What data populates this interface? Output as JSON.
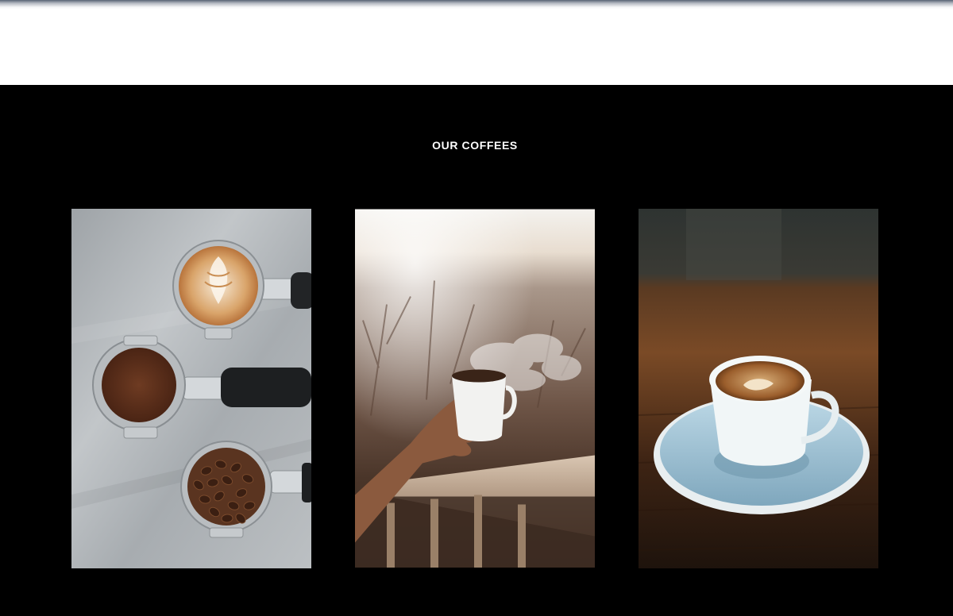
{
  "section": {
    "title": "OUR COFFEES"
  },
  "cards": [
    {
      "image": "portafilters-latte-grounds-beans-photo"
    },
    {
      "image": "hand-holding-steaming-cup-photo"
    },
    {
      "image": "espresso-cup-on-saucer-photo"
    }
  ],
  "colors": {
    "section_background": "#000000",
    "title_text": "#ffffff",
    "page_background": "#ffffff"
  }
}
